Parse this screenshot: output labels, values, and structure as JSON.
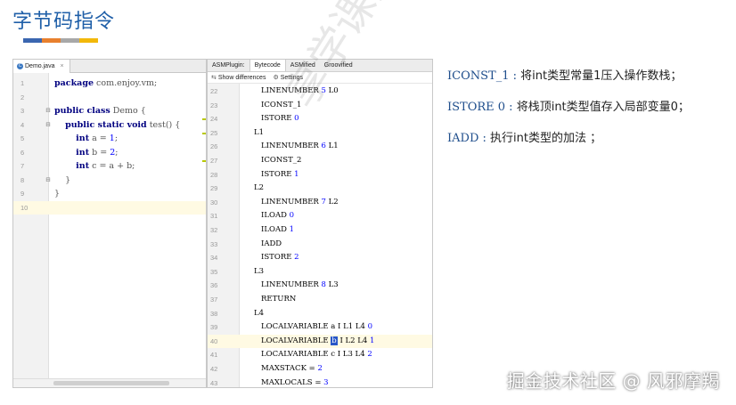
{
  "slide": {
    "title": "字节码指令",
    "accent_colors": [
      "#3a66b0",
      "#e8802e",
      "#a8a8a8",
      "#f2b80a"
    ]
  },
  "editor": {
    "tab_label": "Demo.java",
    "lines": [
      {
        "num": "1",
        "parts": [
          [
            "kw",
            "package"
          ],
          [
            "gray",
            " com.enjoy.vm;"
          ]
        ]
      },
      {
        "num": "2",
        "parts": []
      },
      {
        "num": "3",
        "parts": [
          [
            "kw",
            "public class"
          ],
          [
            "gray",
            " Demo {"
          ]
        ]
      },
      {
        "num": "4",
        "parts": [
          [
            "plain",
            "    "
          ],
          [
            "kw",
            "public static void"
          ],
          [
            "gray",
            " test() {"
          ]
        ]
      },
      {
        "num": "5",
        "parts": [
          [
            "plain",
            "        "
          ],
          [
            "kw",
            "int"
          ],
          [
            "gray",
            " a = "
          ],
          [
            "num",
            "1"
          ],
          [
            "gray",
            ";"
          ]
        ]
      },
      {
        "num": "6",
        "parts": [
          [
            "plain",
            "        "
          ],
          [
            "kw",
            "int"
          ],
          [
            "gray",
            " b = "
          ],
          [
            "num",
            "2"
          ],
          [
            "gray",
            ";"
          ]
        ]
      },
      {
        "num": "7",
        "parts": [
          [
            "plain",
            "        "
          ],
          [
            "kw",
            "int"
          ],
          [
            "gray",
            " c = a + b;"
          ]
        ]
      },
      {
        "num": "8",
        "parts": [
          [
            "gray",
            "    }"
          ]
        ]
      },
      {
        "num": "9",
        "parts": [
          [
            "gray",
            "}"
          ]
        ]
      },
      {
        "num": "10",
        "parts": []
      }
    ]
  },
  "asm": {
    "tabs": [
      "ASMPlugin:",
      "Bytecode",
      "ASMified",
      "Groovified"
    ],
    "active_tab": "Bytecode",
    "toolbar": {
      "show_differences": "Show differences",
      "settings": "Settings"
    },
    "lines": [
      {
        "num": "22",
        "indent": 2,
        "text": "LINENUMBER ",
        "n": "5",
        "rest": " L0"
      },
      {
        "num": "23",
        "indent": 2,
        "text": "ICONST_1",
        "n": "",
        "rest": ""
      },
      {
        "num": "24",
        "indent": 2,
        "text": "ISTORE ",
        "n": "0",
        "rest": ""
      },
      {
        "num": "25",
        "indent": 1,
        "text": "L1",
        "n": "",
        "rest": ""
      },
      {
        "num": "26",
        "indent": 2,
        "text": "LINENUMBER ",
        "n": "6",
        "rest": " L1"
      },
      {
        "num": "27",
        "indent": 2,
        "text": "ICONST_2",
        "n": "",
        "rest": ""
      },
      {
        "num": "28",
        "indent": 2,
        "text": "ISTORE ",
        "n": "1",
        "rest": ""
      },
      {
        "num": "29",
        "indent": 1,
        "text": "L2",
        "n": "",
        "rest": ""
      },
      {
        "num": "30",
        "indent": 2,
        "text": "LINENUMBER ",
        "n": "7",
        "rest": " L2"
      },
      {
        "num": "31",
        "indent": 2,
        "text": "ILOAD ",
        "n": "0",
        "rest": ""
      },
      {
        "num": "32",
        "indent": 2,
        "text": "ILOAD ",
        "n": "1",
        "rest": ""
      },
      {
        "num": "33",
        "indent": 2,
        "text": "IADD",
        "n": "",
        "rest": ""
      },
      {
        "num": "34",
        "indent": 2,
        "text": "ISTORE ",
        "n": "2",
        "rest": ""
      },
      {
        "num": "35",
        "indent": 1,
        "text": "L3",
        "n": "",
        "rest": ""
      },
      {
        "num": "36",
        "indent": 2,
        "text": "LINENUMBER ",
        "n": "8",
        "rest": " L3"
      },
      {
        "num": "37",
        "indent": 2,
        "text": "RETURN",
        "n": "",
        "rest": ""
      },
      {
        "num": "38",
        "indent": 1,
        "text": "L4",
        "n": "",
        "rest": ""
      },
      {
        "num": "39",
        "indent": 2,
        "text": "LOCALVARIABLE a I L1 L4 ",
        "n": "0",
        "rest": ""
      },
      {
        "num": "40",
        "indent": 2,
        "text": "LOCALVARIABLE ",
        "cursor": "b",
        "text2": " I L2 L4 ",
        "n": "1",
        "rest": ""
      },
      {
        "num": "41",
        "indent": 2,
        "text": "LOCALVARIABLE c I L3 L4 ",
        "n": "2",
        "rest": ""
      },
      {
        "num": "42",
        "indent": 2,
        "text": "MAXSTACK = ",
        "n": "2",
        "rest": ""
      },
      {
        "num": "43",
        "indent": 2,
        "text": "MAXLOCALS = ",
        "n": "3",
        "rest": ""
      }
    ]
  },
  "notes": [
    {
      "op": "ICONST_1 :",
      "desc": " 将int类型常量1压入操作数栈；"
    },
    {
      "op": "ISTORE 0 :",
      "desc": " 将栈顶int类型值存入局部变量0；"
    },
    {
      "op": "IADD :",
      "desc": " 执行int类型的加法 ；"
    }
  ],
  "watermark": "享学课堂",
  "footer": "掘金技术社区 @ 风邪摩羯"
}
